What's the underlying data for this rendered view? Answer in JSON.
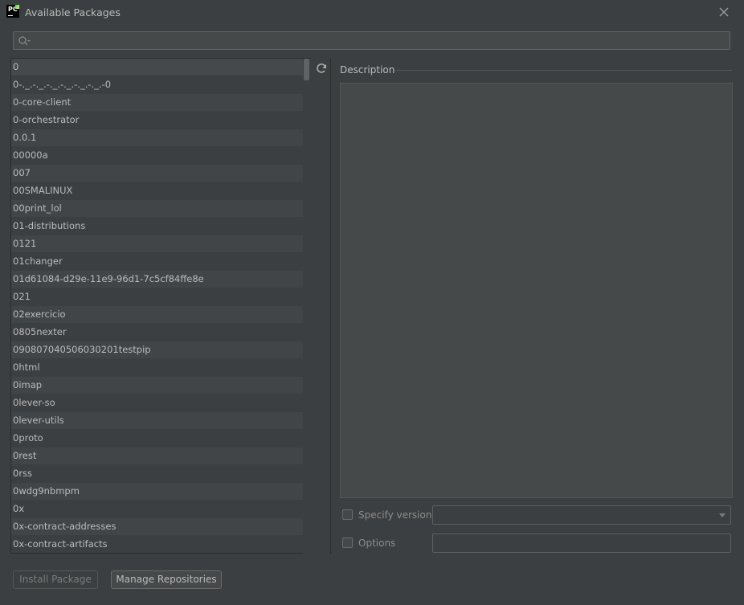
{
  "window": {
    "title": "Available Packages",
    "logo_text": "PC"
  },
  "search": {
    "value": "",
    "placeholder": ""
  },
  "packages": [
    "0",
    "0-._.-._.-._.-._.-._.-._.-0",
    "0-core-client",
    "0-orchestrator",
    "0.0.1",
    "00000a",
    "007",
    "00SMALINUX",
    "00print_lol",
    "01-distributions",
    "0121",
    "01changer",
    "01d61084-d29e-11e9-96d1-7c5cf84ffe8e",
    "021",
    "02exercicio",
    "0805nexter",
    "090807040506030201testpip",
    "0html",
    "0imap",
    "0lever-so",
    "0lever-utils",
    "0proto",
    "0rest",
    "0rss",
    "0wdg9nbmpm",
    "0x",
    "0x-contract-addresses",
    "0x-contract-artifacts"
  ],
  "description": {
    "label": "Description",
    "text": ""
  },
  "options": {
    "specify_version_label": "Specify version",
    "specify_version_checked": false,
    "version_value": "",
    "options_label": "Options",
    "options_checked": false,
    "options_value": ""
  },
  "buttons": {
    "install": "Install Package",
    "manage": "Manage Repositories"
  },
  "icons": {
    "close": "close-icon",
    "search": "search-icon",
    "refresh": "refresh-icon"
  }
}
